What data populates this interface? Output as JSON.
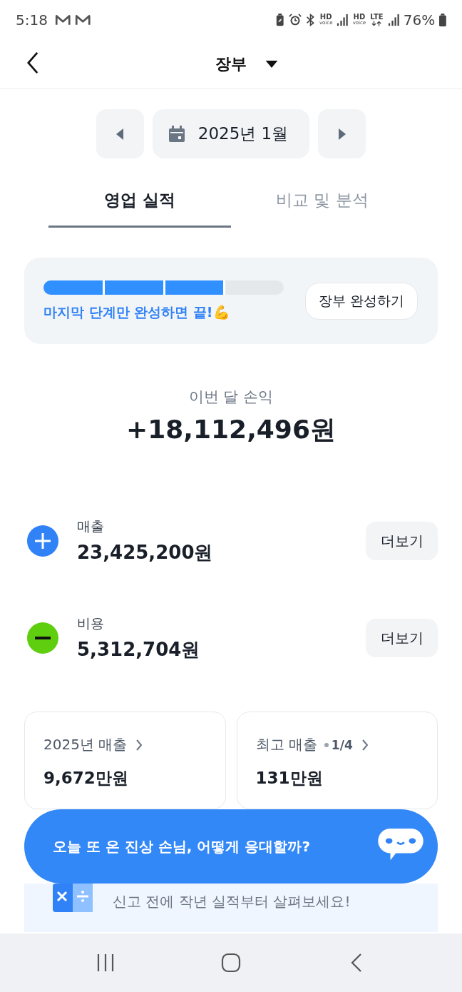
{
  "status_bar": {
    "time": "5:18",
    "notifications": [
      {
        "kind": "mail"
      },
      {
        "kind": "mail"
      }
    ],
    "indicators": [
      {
        "kind": "app"
      },
      {
        "kind": "alarm"
      },
      {
        "kind": "bluetooth"
      },
      {
        "kind": "hd",
        "top": "HD",
        "bottom": "voice"
      },
      {
        "kind": "signal"
      },
      {
        "kind": "hd",
        "top": "HD",
        "bottom": "voice"
      },
      {
        "kind": "lte",
        "text": "LTE"
      },
      {
        "kind": "signal"
      }
    ],
    "battery": "76%"
  },
  "header": {
    "title": "장부"
  },
  "month_nav": {
    "label": "2025년 1월"
  },
  "tabs": [
    {
      "label": "영업 실적",
      "selected": true
    },
    {
      "label": "비교 및 분석",
      "selected": false
    }
  ],
  "progress_card": {
    "level": 0.75,
    "message": "마지막 단계만 완성하면 끝!💪",
    "button": "장부 완성하기"
  },
  "profit": {
    "label": "이번 달 손익",
    "amount": "+18,112,496원"
  },
  "entries": [
    {
      "kind": "income",
      "label": "매출",
      "amount": "23,425,200원",
      "button": "더보기"
    },
    {
      "kind": "expense",
      "label": "비용",
      "amount": "5,312,704원",
      "button": "더보기"
    }
  ],
  "summary_cards": [
    {
      "title": "2025년 매출",
      "amount": "9,672만원"
    },
    {
      "title": "최고 매출",
      "badge": "1/4",
      "amount": "131만원"
    }
  ],
  "tip_card": {
    "text": "신고 전에 작년 실적부터 살펴보세요!"
  },
  "chat_banner": {
    "text": "오늘 또 온 진상 손님, 어떻게 응대할까?"
  },
  "nav_bar": [
    {
      "kind": "recents"
    },
    {
      "kind": "home"
    },
    {
      "kind": "back"
    }
  ]
}
